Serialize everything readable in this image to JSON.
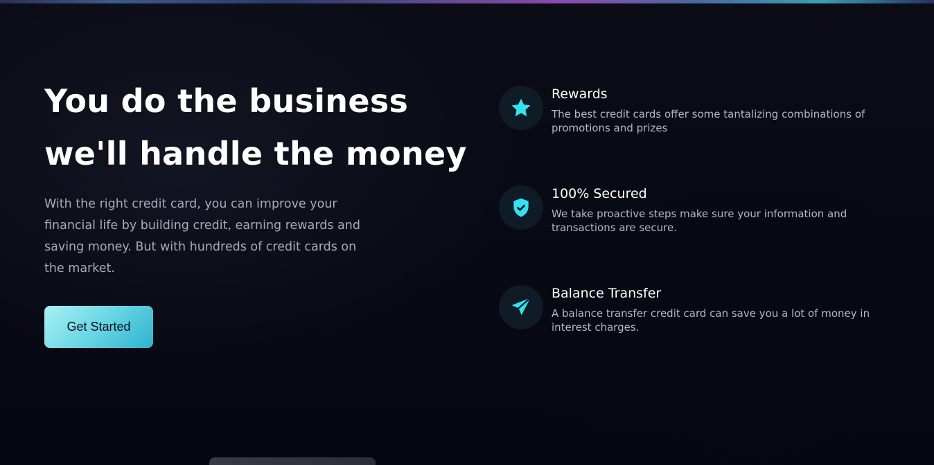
{
  "hero": {
    "title_line1": "You do the business",
    "title_line2": "we'll handle the money",
    "description": "With the right credit card, you can improve your financial life by building credit, earning rewards and saving money. But with hundreds of credit cards on the market.",
    "cta_label": "Get Started"
  },
  "features": [
    {
      "icon": "star-icon",
      "title": "Rewards",
      "description": "The best credit cards offer some tantalizing combinations of promotions and prizes"
    },
    {
      "icon": "shield-check-icon",
      "title": "100% Secured",
      "description": "We take proactive steps make sure your information and transactions are secure."
    },
    {
      "icon": "send-icon",
      "title": "Balance Transfer",
      "description": "A balance transfer credit card can save you a lot of money in interest charges."
    }
  ],
  "colors": {
    "background": "#0a0b14",
    "accent": "#33e1f0",
    "icon_bg": "#0f1b25",
    "text_muted": "#a9abb6"
  }
}
